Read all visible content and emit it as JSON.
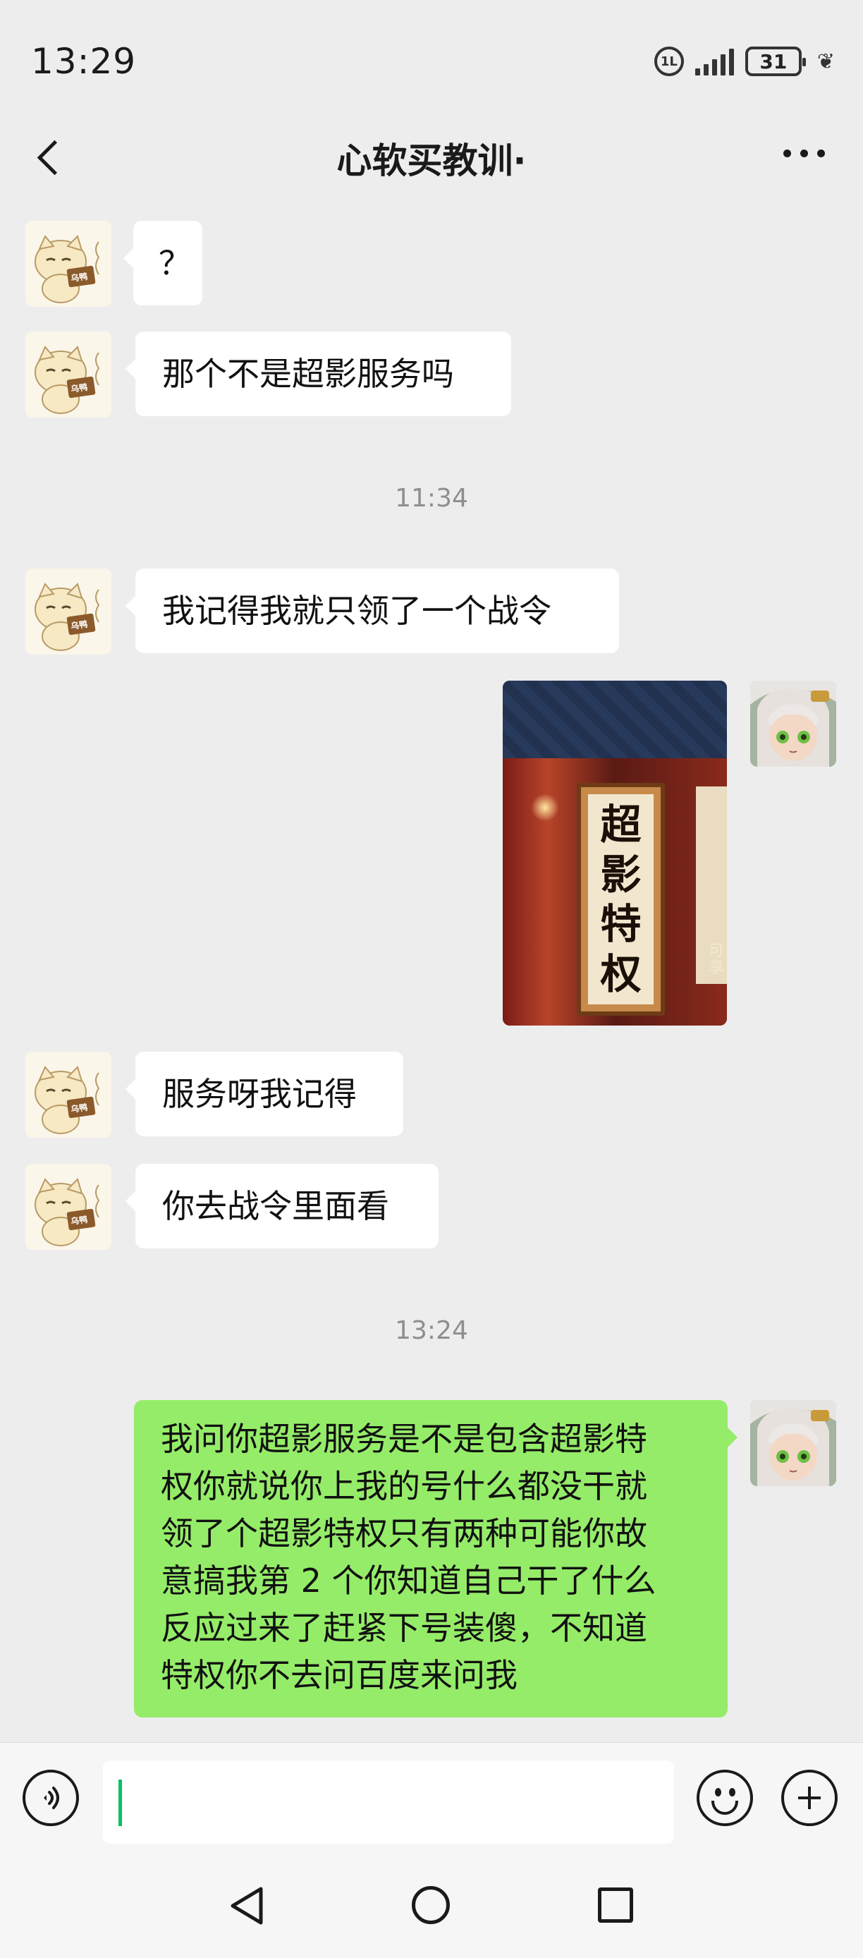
{
  "status_bar": {
    "time": "13:29",
    "network_label": "1L",
    "battery_level": "31"
  },
  "nav": {
    "title": "心软买教训·"
  },
  "messages": [
    {
      "sender": "contact",
      "type": "text",
      "text": "？"
    },
    {
      "sender": "contact",
      "type": "text",
      "text": "那个不是超影服务吗"
    },
    {
      "type": "timestamp",
      "text": "11:34"
    },
    {
      "sender": "contact",
      "type": "text",
      "text": "我记得我就只领了一个战令"
    },
    {
      "sender": "me",
      "type": "image",
      "image_text": [
        "超",
        "影",
        "特",
        "权"
      ],
      "side_text": "可享"
    },
    {
      "sender": "contact",
      "type": "text",
      "text": "服务呀我记得"
    },
    {
      "sender": "contact",
      "type": "text",
      "text": "你去战令里面看"
    },
    {
      "type": "timestamp",
      "text": "13:24"
    },
    {
      "sender": "me",
      "type": "text",
      "lines": [
        "我问你超影服务是不是包含超影特",
        "权你就说你上我的号什么都没干就",
        "领了个超影特权只有两种可能你故",
        "意搞我第 2 个你知道自己干了什么",
        "反应过来了赶紧下号装傻，不知道",
        "特权你不去问百度来问我"
      ]
    }
  ],
  "input": {
    "value": "",
    "placeholder": ""
  },
  "colors": {
    "background": "#ededed",
    "bubble_contact": "#ffffff",
    "bubble_me": "#95ec69",
    "cursor": "#07c160"
  },
  "icons": {
    "voice": "voice-icon",
    "emoji": "emoji-icon",
    "plus": "plus-icon",
    "back": "back-icon",
    "more": "more-icon"
  }
}
